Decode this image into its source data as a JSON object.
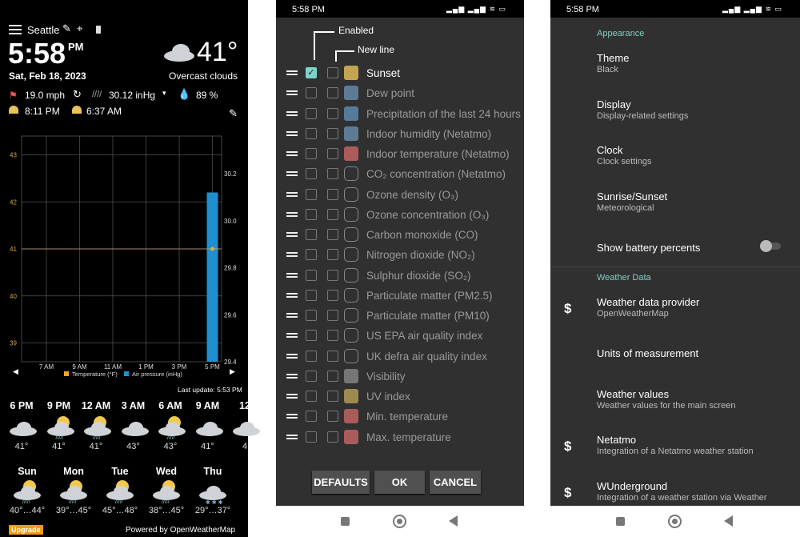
{
  "main_screen": {
    "location": "Seattle",
    "time": "5:58",
    "ampm": "PM",
    "date": "Sat, Feb 18, 2023",
    "temperature": "41°",
    "condition": "Overcast clouds",
    "wind": "19.0 mph",
    "pressure": "30.12 inHg",
    "humidity": "89 %",
    "sunset": "8:11 PM",
    "sunrise": "6:37 AM",
    "last_update": "Last update: 5:53 PM",
    "hourly": [
      {
        "time": "6 PM",
        "temp": "41°",
        "icon": "cloudy"
      },
      {
        "time": "9 PM",
        "temp": "41°",
        "icon": "sun-rain"
      },
      {
        "time": "12 AM",
        "temp": "41°",
        "icon": "sun-rain"
      },
      {
        "time": "3 AM",
        "temp": "43°",
        "icon": "cloudy"
      },
      {
        "time": "6 AM",
        "temp": "43°",
        "icon": "sun-rain"
      },
      {
        "time": "9 AM",
        "temp": "41°",
        "icon": "cloudy"
      },
      {
        "time": "12",
        "temp": "4",
        "icon": "cloudy"
      }
    ],
    "daily": [
      {
        "day": "Sun",
        "range": "40°…44°",
        "icon": "sun-rain"
      },
      {
        "day": "Mon",
        "range": "39°…45°",
        "icon": "sun-rain"
      },
      {
        "day": "Tue",
        "range": "45°…48°",
        "icon": "sun-rain"
      },
      {
        "day": "Wed",
        "range": "38°…45°",
        "icon": "sun-rain"
      },
      {
        "day": "Thu",
        "range": "29°…37°",
        "icon": "snow"
      }
    ],
    "upgrade": "Upgrade",
    "powered_by": "Powered by OpenWeatherMap"
  },
  "chart_data": {
    "type": "bar+line",
    "x_ticks": [
      "7 AM",
      "9 AM",
      "11 AM",
      "1 PM",
      "3 PM",
      "5 PM"
    ],
    "left_axis": {
      "ticks": [
        "39",
        "40",
        "41",
        "42",
        "43"
      ],
      "range": [
        38.6,
        43.4
      ]
    },
    "right_axis": {
      "ticks": [
        "29.4",
        "29.6",
        "29.8",
        "30.0",
        "30.2"
      ],
      "range": [
        29.4,
        30.36
      ]
    },
    "series": [
      {
        "name": "Temperature (°F)",
        "type": "line",
        "color": "#f5a623",
        "x": [
          "5 PM"
        ],
        "values": [
          41
        ]
      },
      {
        "name": "Air pressure (inHg)",
        "type": "bar",
        "color": "#1e90d0",
        "x": [
          "5 PM"
        ],
        "values": [
          30.12
        ]
      }
    ],
    "grid": true,
    "legend": "bottom"
  },
  "status_time": "5:58 PM",
  "battery": "53",
  "values_dialog": {
    "enabled_label": "Enabled",
    "newline_label": "New line",
    "items": [
      {
        "label": "Sunset",
        "enabled": true,
        "newline": false,
        "icon": "sunset"
      },
      {
        "label": "Dew point",
        "enabled": false,
        "newline": false,
        "icon": "dew-point"
      },
      {
        "label": "Precipitation of the last 24 hours",
        "enabled": false,
        "newline": false,
        "icon": "umbrella"
      },
      {
        "label": "Indoor humidity (Netatmo)",
        "enabled": false,
        "newline": false,
        "icon": "humidity"
      },
      {
        "label": "Indoor temperature (Netatmo)",
        "enabled": false,
        "newline": false,
        "icon": "thermometer"
      },
      {
        "label": "CO₂ concentration (Netatmo)",
        "enabled": false,
        "newline": false,
        "icon": "co2"
      },
      {
        "label": "Ozone density (O₃)",
        "enabled": false,
        "newline": false,
        "icon": "o3"
      },
      {
        "label": "Ozone concentration (O₃)",
        "enabled": false,
        "newline": false,
        "icon": "o3"
      },
      {
        "label": "Carbon monoxide (CO)",
        "enabled": false,
        "newline": false,
        "icon": "co"
      },
      {
        "label": "Nitrogen dioxide (NO₂)",
        "enabled": false,
        "newline": false,
        "icon": "no2"
      },
      {
        "label": "Sulphur dioxide (SO₂)",
        "enabled": false,
        "newline": false,
        "icon": "so2"
      },
      {
        "label": "Particulate matter (PM2.5)",
        "enabled": false,
        "newline": false,
        "icon": "pm"
      },
      {
        "label": "Particulate matter (PM10)",
        "enabled": false,
        "newline": false,
        "icon": "pm"
      },
      {
        "label": "US EPA air quality index",
        "enabled": false,
        "newline": false,
        "icon": "epa"
      },
      {
        "label": "UK defra air quality index",
        "enabled": false,
        "newline": false,
        "icon": "defra"
      },
      {
        "label": "Visibility",
        "enabled": false,
        "newline": false,
        "icon": "binoculars"
      },
      {
        "label": "UV index",
        "enabled": false,
        "newline": false,
        "icon": "uv"
      },
      {
        "label": "Min. temperature",
        "enabled": false,
        "newline": false,
        "icon": "thermometer-min"
      },
      {
        "label": "Max. temperature",
        "enabled": false,
        "newline": false,
        "icon": "thermometer-max"
      }
    ],
    "buttons": {
      "defaults": "DEFAULTS",
      "ok": "OK",
      "cancel": "CANCEL"
    }
  },
  "settings": {
    "sections": [
      {
        "title": "Appearance",
        "items": [
          {
            "title": "Theme",
            "summary": "Black"
          },
          {
            "title": "Display",
            "summary": "Display-related settings"
          },
          {
            "title": "Clock",
            "summary": "Clock settings"
          },
          {
            "title": "Sunrise/Sunset",
            "summary": "Meteorological"
          },
          {
            "title": "Show battery percents",
            "toggle": false
          }
        ]
      },
      {
        "title": "Weather Data",
        "items": [
          {
            "title": "Weather data provider",
            "summary": "OpenWeatherMap",
            "premium": true
          },
          {
            "title": "Units of measurement"
          },
          {
            "title": "Weather values",
            "summary": "Weather values for the main screen"
          },
          {
            "title": "Netatmo",
            "summary": "Integration of a Netatmo weather station",
            "premium": true
          },
          {
            "title": "WUnderground",
            "summary": "Integration of a weather station via Weather",
            "premium": true
          }
        ]
      }
    ],
    "premium_icon": "$"
  },
  "colors": {
    "accent": "#7fd3c9",
    "panel": "#303030",
    "bar": "#1e90d0",
    "temp": "#f5a623",
    "upgrade": "#f39c12"
  }
}
